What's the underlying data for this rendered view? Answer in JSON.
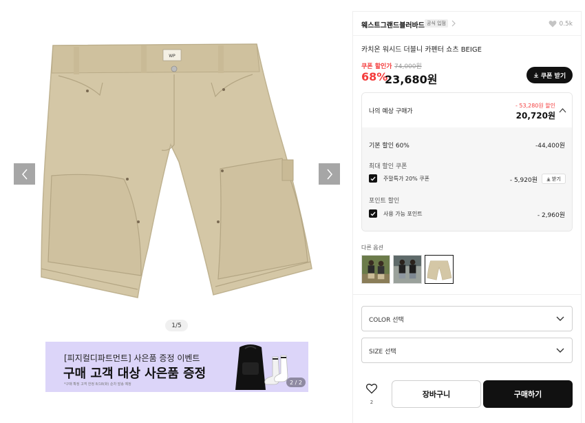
{
  "gallery": {
    "pager": "1/5",
    "banner": {
      "subtitle": "[피지컬디파트먼트] 사은품 증정 이벤트",
      "title": "구매 고객 대상 사은품 증정",
      "note": "*구매 확정 고객 한정 8/18(화) 순차 발송 예정",
      "page": "2 / 2",
      "bg_color": "#dcd5f9"
    },
    "product_label_text": "WP"
  },
  "brand": {
    "name": "웨스트그랜드블러바드",
    "badge": "공식 입점",
    "likes": "0.5k"
  },
  "product": {
    "name": "카치온 워시드 더블니 카펜터 쇼츠 BEIGE",
    "coupon_price_label": "쿠폰 할인가",
    "original_price": "74,000원",
    "discount_rate": "68%",
    "sale_price": "23,680원",
    "coupon_button": "쿠폰 받기",
    "accent_color": "#f43c3c"
  },
  "estimate": {
    "label": "나의 예상 구매가",
    "saving": "- 53,280원 할인",
    "final_price": "20,720원",
    "base_discount_label": "기본 할인 60%",
    "base_discount_value": "-44,400원",
    "max_coupon_section": "최대 할인 쿠폰",
    "coupon_label": "주말특가 20% 쿠폰",
    "coupon_value": "- 5,920원",
    "coupon_get_button": "받기",
    "point_section": "포인트 할인",
    "point_label": "사용 가능 포인트",
    "point_value": "- 2,960원"
  },
  "options": {
    "other_label": "다른 옵션",
    "color_select": "COLOR 선택",
    "size_select": "SIZE 선택"
  },
  "actions": {
    "wish_count": "2",
    "cart_button": "장바구니",
    "buy_button": "구매하기"
  }
}
